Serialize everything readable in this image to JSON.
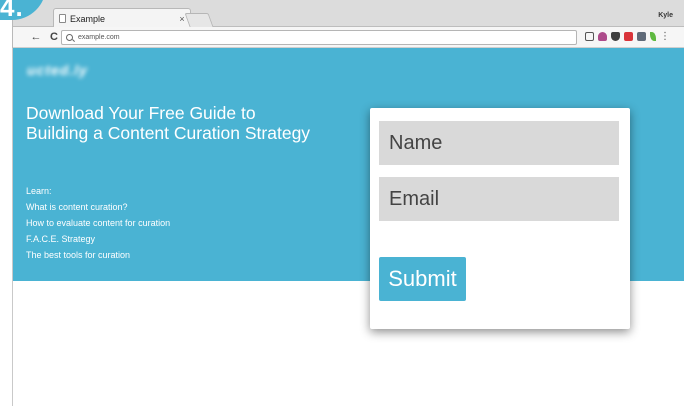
{
  "badge": {
    "step": "4."
  },
  "browser": {
    "tab_title": "Example",
    "tab_close": "×",
    "profile_name": "Kyle",
    "back_glyph": "←",
    "reload_glyph": "C",
    "address": "example.com",
    "menu_glyph": "⋮",
    "extension_icons": [
      "cast-icon",
      "heart-extension-icon",
      "pocket-icon",
      "red-extension-icon",
      "ghostery-icon",
      "evernote-icon"
    ]
  },
  "page": {
    "logo_text": "ucted.ly",
    "headline": "Download Your Free Guide to Building a Content Curation Strategy",
    "learn_items": [
      "Learn:",
      "What is content curation?",
      "How to evaluate content for curation",
      "F.A.C.E. Strategy",
      "The best tools for curation"
    ],
    "form": {
      "name_placeholder": "Name",
      "email_placeholder": "Email",
      "submit_label": "Submit"
    }
  },
  "colors": {
    "brand": "#4ab3d3",
    "field_bg": "#d9d9d9",
    "text_on_brand": "#ffffff"
  }
}
